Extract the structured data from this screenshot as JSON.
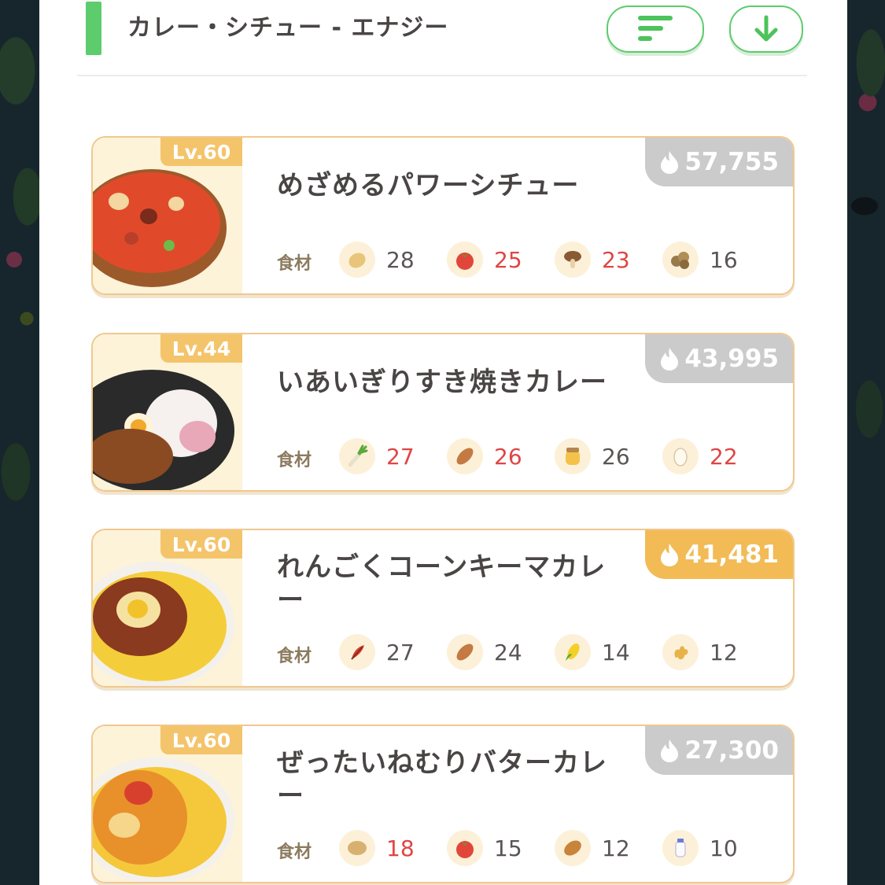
{
  "header": {
    "title": "カレー・シチュー - エナジー",
    "sort_icon": "sort-icon",
    "download_icon": "arrow-down-icon",
    "accent_color": "#5dcc6c"
  },
  "ingredient_label": "食材",
  "recipes": [
    {
      "level": "Lv.60",
      "name": "めざめるパワーシチュー",
      "energy": "57,755",
      "energy_highlight": false,
      "ingredients": [
        {
          "icon": "potato-icon",
          "count": "28",
          "short": false
        },
        {
          "icon": "tomato-icon",
          "count": "25",
          "short": true
        },
        {
          "icon": "mushroom-icon",
          "count": "23",
          "short": true
        },
        {
          "icon": "soybeans-icon",
          "count": "16",
          "short": false
        }
      ]
    },
    {
      "level": "Lv.44",
      "name": "いあいぎりすき焼きカレー",
      "energy": "43,995",
      "energy_highlight": false,
      "ingredients": [
        {
          "icon": "leek-icon",
          "count": "27",
          "short": true
        },
        {
          "icon": "sausage-icon",
          "count": "26",
          "short": true
        },
        {
          "icon": "honey-icon",
          "count": "26",
          "short": false
        },
        {
          "icon": "egg-icon",
          "count": "22",
          "short": true
        }
      ]
    },
    {
      "level": "Lv.60",
      "name": "れんごくコーンキーマカレー",
      "energy": "41,481",
      "energy_highlight": true,
      "ingredients": [
        {
          "icon": "herb-icon",
          "count": "27",
          "short": false
        },
        {
          "icon": "sausage-icon",
          "count": "24",
          "short": false
        },
        {
          "icon": "corn-icon",
          "count": "14",
          "short": false
        },
        {
          "icon": "ginger-icon",
          "count": "12",
          "short": false
        }
      ]
    },
    {
      "level": "Lv.60",
      "name": "ぜったいねむりバターカレー",
      "energy": "27,300",
      "energy_highlight": false,
      "ingredients": [
        {
          "icon": "potato-icon",
          "count": "18",
          "short": true
        },
        {
          "icon": "tomato-icon",
          "count": "15",
          "short": false
        },
        {
          "icon": "bread-icon",
          "count": "12",
          "short": false
        },
        {
          "icon": "milk-icon",
          "count": "10",
          "short": false
        }
      ]
    }
  ]
}
